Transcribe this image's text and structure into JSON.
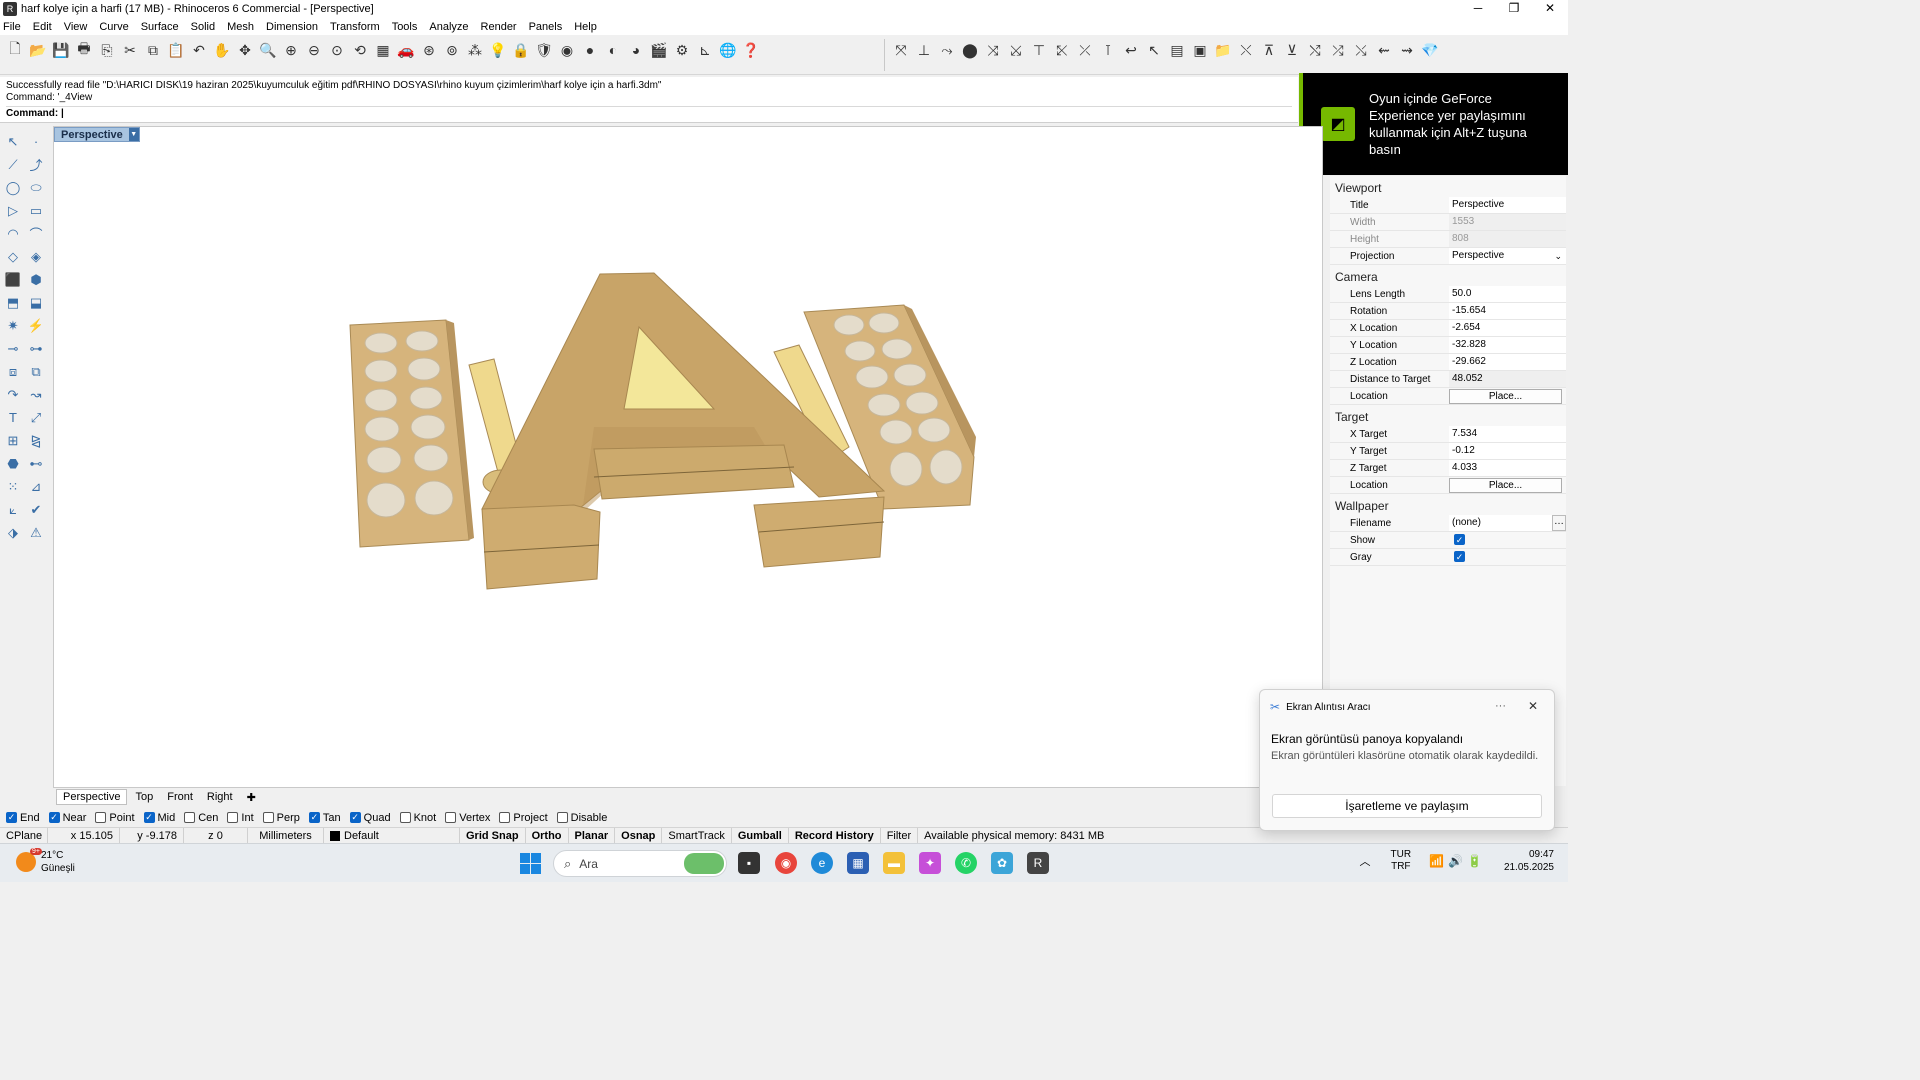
{
  "window": {
    "title": "harf kolye için a harfi (17 MB) - Rhinoceros 6 Commercial - [Perspective]",
    "controls": [
      "─",
      "❐",
      "✕"
    ]
  },
  "menu": [
    "File",
    "Edit",
    "View",
    "Curve",
    "Surface",
    "Solid",
    "Mesh",
    "Dimension",
    "Transform",
    "Tools",
    "Analyze",
    "Render",
    "Panels",
    "Help"
  ],
  "command": {
    "history_line1": "Successfully read file \"D:\\HARICI DISK\\19 haziran 2025\\kuyumculuk eğitim pdf\\RHINO DOSYASI\\rhino kuyum çizimlerim\\harf kolye için a harfi.3dm\"",
    "history_line2": "Command: '_4View",
    "prompt": "Command:"
  },
  "viewport": {
    "label": "Perspective",
    "model_color": "#d4b27a",
    "tabs": [
      "Perspective",
      "Top",
      "Front",
      "Right"
    ]
  },
  "osnap": [
    {
      "label": "End",
      "on": true
    },
    {
      "label": "Near",
      "on": true
    },
    {
      "label": "Point",
      "on": false
    },
    {
      "label": "Mid",
      "on": true
    },
    {
      "label": "Cen",
      "on": false
    },
    {
      "label": "Int",
      "on": false
    },
    {
      "label": "Perp",
      "on": false
    },
    {
      "label": "Tan",
      "on": true
    },
    {
      "label": "Quad",
      "on": true
    },
    {
      "label": "Knot",
      "on": false
    },
    {
      "label": "Vertex",
      "on": false
    },
    {
      "label": "Project",
      "on": false
    },
    {
      "label": "Disable",
      "on": false
    }
  ],
  "status": {
    "cplane": "CPlane",
    "x": "x 15.105",
    "y": "y -9.178",
    "z": "z 0",
    "units": "Millimeters",
    "layer": "Default",
    "grid_snap": "Grid Snap",
    "ortho": "Ortho",
    "planar": "Planar",
    "osnap": "Osnap",
    "smarttrack": "SmartTrack",
    "gumball": "Gumball",
    "record_history": "Record History",
    "filter": "Filter",
    "memory": "Available physical memory: 8431 MB"
  },
  "panel": {
    "viewport_section": "Viewport",
    "title_label": "Title",
    "title_value": "Perspective",
    "width_label": "Width",
    "width_value": "1553",
    "height_label": "Height",
    "height_value": "808",
    "projection_label": "Projection",
    "projection_value": "Perspective",
    "camera_section": "Camera",
    "lens_label": "Lens Length",
    "lens_value": "50.0",
    "rotation_label": "Rotation",
    "rotation_value": "-15.654",
    "xloc_label": "X Location",
    "xloc_value": "-2.654",
    "yloc_label": "Y Location",
    "yloc_value": "-32.828",
    "zloc_label": "Z Location",
    "zloc_value": "-29.662",
    "dist_label": "Distance to Target",
    "dist_value": "48.052",
    "camloc_label": "Location",
    "camloc_button": "Place...",
    "target_section": "Target",
    "xt_label": "X Target",
    "xt_value": "7.534",
    "yt_label": "Y Target",
    "yt_value": "-0.12",
    "zt_label": "Z Target",
    "zt_value": "4.033",
    "tloc_label": "Location",
    "tloc_button": "Place...",
    "wallpaper_section": "Wallpaper",
    "filename_label": "Filename",
    "filename_value": "(none)",
    "show_label": "Show",
    "show_on": true,
    "gray_label": "Gray",
    "gray_on": true
  },
  "geforce": {
    "message": "Oyun içinde GeForce Experience yer paylaşımını kullanmak için Alt+Z tuşuna basın",
    "accent": "#76b900"
  },
  "toast": {
    "app": "Ekran Alıntısı Aracı",
    "title": "Ekran görüntüsü panoya kopyalandı",
    "body": "Ekran görüntüleri klasörüne otomatik olarak kaydedildi.",
    "button": "İşaretleme ve paylaşım"
  },
  "taskbar": {
    "temp": "21°C",
    "weather": "Güneşli",
    "weather_badge": "9+",
    "search_placeholder": "Ara",
    "lang_top": "TUR",
    "lang_bottom": "TRF",
    "time": "09:47",
    "date": "21.05.2025"
  }
}
